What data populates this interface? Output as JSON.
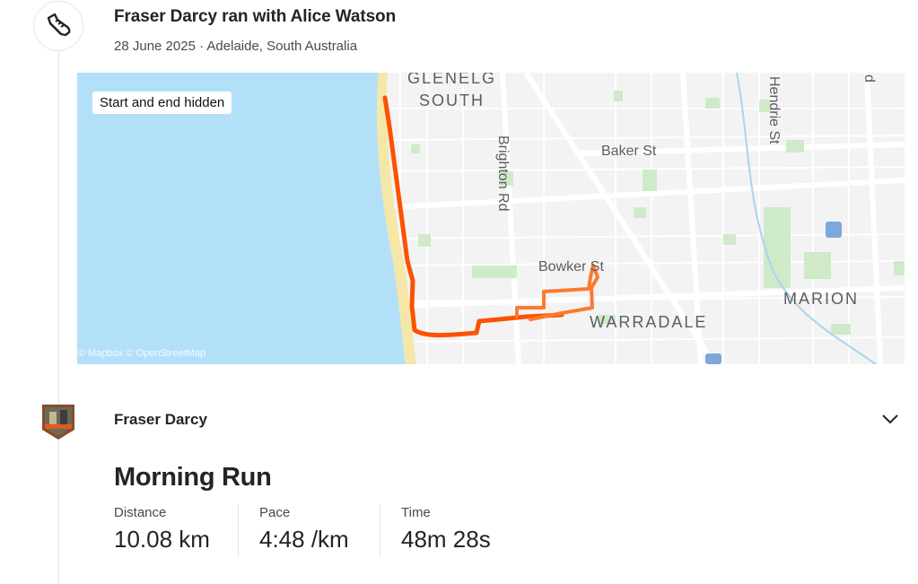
{
  "header": {
    "title": "Fraser Darcy ran with Alice Watson",
    "subtitle": "28 June 2025 · Adelaide, South Australia"
  },
  "map": {
    "badge": "Start and end hidden",
    "credit": "© Mapbox © OpenStreetMap",
    "labels": {
      "glenelg": "GLENELG",
      "south": "SOUTH",
      "brighton_rd": "Brighton Rd",
      "baker_st": "Baker St",
      "hendrie_st": "Hendrie St",
      "bowker_st": "Bowker St",
      "warradale": "WARRADALE",
      "marion": "MARION",
      "edge_d": "d"
    },
    "colors": {
      "sea": "#b3e0f9",
      "route": "#fc5200",
      "park": "#cfeac8"
    }
  },
  "athlete": {
    "name": "Fraser Darcy"
  },
  "activity": {
    "name": "Morning Run",
    "stats": [
      {
        "label": "Distance",
        "value": "10.08 km"
      },
      {
        "label": "Pace",
        "value": "4:48 /km"
      },
      {
        "label": "Time",
        "value": "48m 28s"
      }
    ]
  }
}
